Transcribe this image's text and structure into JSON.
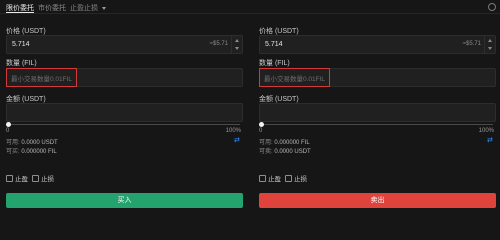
{
  "tabs": {
    "items": [
      {
        "label": "限价委托",
        "active": true
      },
      {
        "label": "市价委托",
        "active": false
      },
      {
        "label": "止盈止损",
        "active": false
      }
    ]
  },
  "buy": {
    "price_label": "价格 (USDT)",
    "price_value": "5.714",
    "price_approx": "≈$5.71",
    "qty_label": "数量 (FIL)",
    "qty_placeholder": "最小交易数量0.01FIL",
    "amount_label": "金额 (USDT)",
    "slider_min": "0",
    "slider_max": "100%",
    "slider_value_percent": 0,
    "avail_label": "可用:",
    "avail_value": "0.0000 USDT",
    "buyable_label": "可买:",
    "buyable_value": "0.000000 FIL",
    "tp_label": "止盈",
    "sl_label": "止损",
    "action_label": "买入",
    "action_color": "#25a36f"
  },
  "sell": {
    "price_label": "价格 (USDT)",
    "price_value": "5.714",
    "price_approx": "≈$5.71",
    "qty_label": "数量 (FIL)",
    "qty_placeholder": "最小交易数量0.01FIL",
    "amount_label": "金额 (USDT)",
    "slider_min": "0",
    "slider_max": "100%",
    "slider_value_percent": 0,
    "avail_label": "可用:",
    "avail_value": "0.000000 FIL",
    "sellable_label": "可卖:",
    "sellable_value": "0.0000 USDT",
    "tp_label": "止盈",
    "sl_label": "止损",
    "action_label": "卖出",
    "action_color": "#e0433b"
  },
  "colors": {
    "background": "#161616",
    "highlight": "#d23a3a",
    "swap_icon": "#2f8cff"
  }
}
